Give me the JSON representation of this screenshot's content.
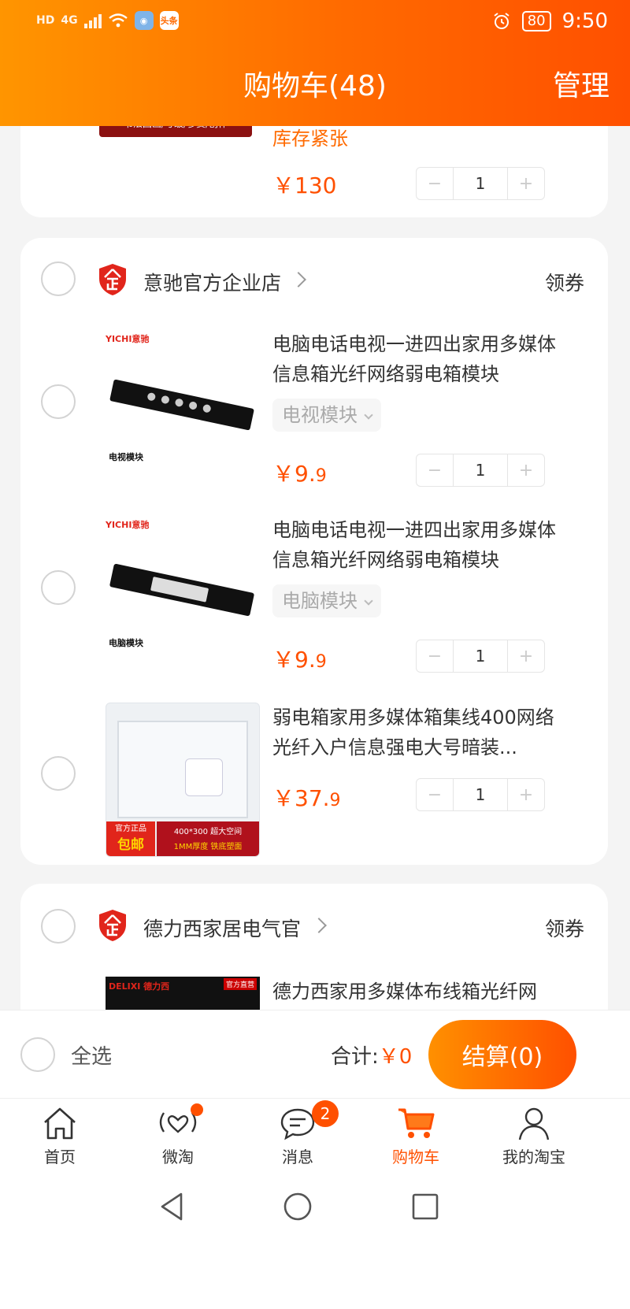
{
  "status_bar": {
    "hd": "HD",
    "network": "4G",
    "toutiao_badge": "头条",
    "battery": "80",
    "time": "9:50"
  },
  "header": {
    "title": "购物车(48)",
    "manage": "管理"
  },
  "prev_item": {
    "thumb_caption": "书法国画/考级/参赛/创作",
    "stock": "库存紧张",
    "currency": "￥",
    "price": "130",
    "qty": "1"
  },
  "stores": [
    {
      "name": "意驰官方企业店",
      "coupon": "领券",
      "items": [
        {
          "brand": "YICHI意驰",
          "thumb_label": "电视模块",
          "title": "电脑电话电视一进四出家用多媒体信息箱光纤网络弱电箱模块",
          "variant": "电视模块",
          "currency": "￥",
          "price_int": "9.",
          "price_dec": "9",
          "qty": "1"
        },
        {
          "brand": "YICHI意驰",
          "thumb_label": "电脑模块",
          "title": "电脑电话电视一进四出家用多媒体信息箱光纤网络弱电箱模块",
          "variant": "电脑模块",
          "currency": "￥",
          "price_int": "9.",
          "price_dec": "9",
          "qty": "1"
        },
        {
          "thumb_tag1": "官方正品",
          "thumb_tag2": "包邮",
          "thumb_spec": "400*300 超大空间",
          "thumb_spec2": "1MM厚度 铁底塑面",
          "title": "弱电箱家用多媒体箱集线400网络光纤入户信息强电大号暗装...",
          "currency": "￥",
          "price_int": "37.",
          "price_dec": "9",
          "qty": "1"
        }
      ]
    },
    {
      "name": "德力西家居电气官",
      "coupon": "领券",
      "items": [
        {
          "thumb_brand": "DELIXI 德力西",
          "thumb_tag": "官方直营",
          "title": "德力西家用多媒体布线箱光纤网"
        }
      ]
    }
  ],
  "checkout": {
    "select_all": "全选",
    "total_label": "合计:",
    "total_currency": "￥",
    "total_value": "0",
    "pay_button": "结算(0)"
  },
  "tabbar": {
    "tabs": [
      {
        "label": "首页"
      },
      {
        "label": "微淘"
      },
      {
        "label": "消息",
        "badge": "2"
      },
      {
        "label": "购物车"
      },
      {
        "label": "我的淘宝"
      }
    ]
  },
  "stepper": {
    "minus": "−",
    "plus": "+"
  },
  "colors": {
    "accent": "#ff5000",
    "header_start": "#ff9500",
    "header_end": "#ff5000"
  }
}
